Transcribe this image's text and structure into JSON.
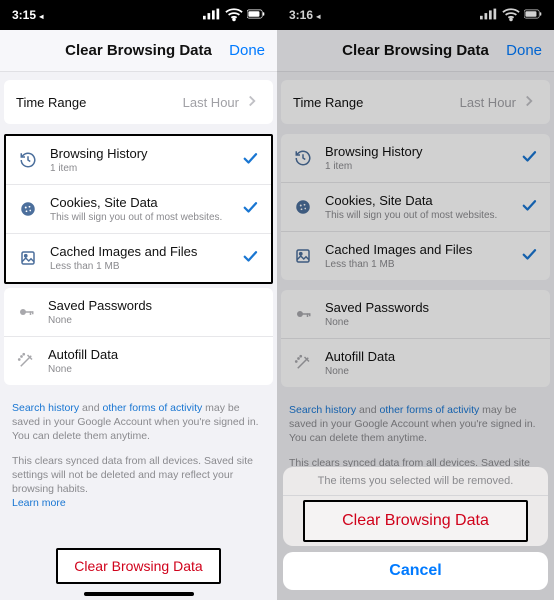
{
  "panes": [
    {
      "time": "3:15",
      "timeSuffix": "◂"
    },
    {
      "time": "3:16",
      "timeSuffix": "◂"
    }
  ],
  "nav": {
    "title": "Clear Browsing Data",
    "done": "Done"
  },
  "timerange": {
    "label": "Time Range",
    "value": "Last Hour"
  },
  "items": [
    {
      "key": "history",
      "label": "Browsing History",
      "sub": "1 item",
      "checked": true,
      "muted": false
    },
    {
      "key": "cookies",
      "label": "Cookies, Site Data",
      "sub": "This will sign you out of most websites.",
      "checked": true,
      "muted": false
    },
    {
      "key": "cache",
      "label": "Cached Images and Files",
      "sub": "Less than 1 MB",
      "checked": true,
      "muted": false
    },
    {
      "key": "passwords",
      "label": "Saved Passwords",
      "sub": "None",
      "checked": false,
      "muted": true
    },
    {
      "key": "autofill",
      "label": "Autofill Data",
      "sub": "None",
      "checked": false,
      "muted": true
    }
  ],
  "info1": {
    "link1": "Search history",
    "mid1": " and ",
    "link2": "other forms of activity",
    "rest": " may be saved in your Google Account when you're signed in. You can delete them anytime."
  },
  "info2": {
    "text": "This clears synced data from all devices. Saved site settings will not be deleted and may reflect your browsing habits.",
    "link": "Learn more"
  },
  "clearButton": "Clear Browsing Data",
  "sheet": {
    "message": "The items you selected will be removed.",
    "destructive": "Clear Browsing Data",
    "cancel": "Cancel"
  }
}
